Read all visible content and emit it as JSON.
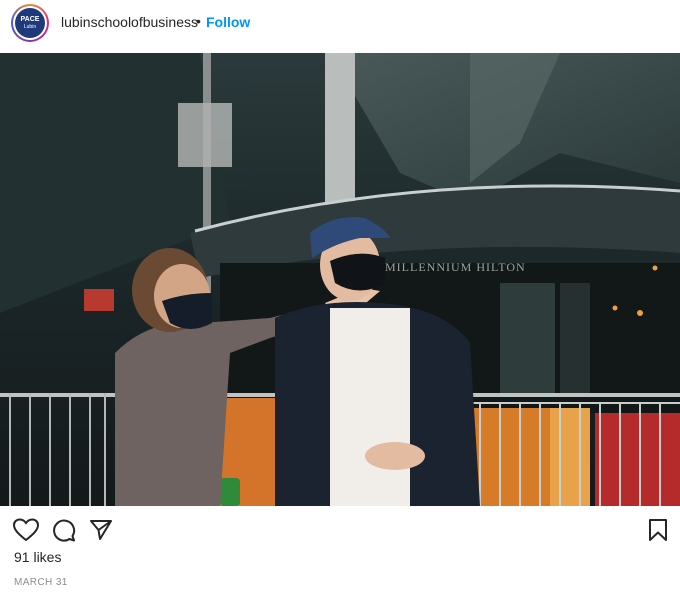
{
  "post": {
    "username": "lubinschoolofbusiness",
    "separator": "•",
    "follow_label": "Follow",
    "avatar": {
      "line1": "PACE",
      "line2": "Lubin",
      "color": "#1e3a7b"
    },
    "photo_sign_text": "MILLENNIUM HILTON",
    "likes_text": "91 likes",
    "date_text": "MARCH 31"
  },
  "icons": {
    "like": "heart-icon",
    "comment": "comment-icon",
    "share": "paper-plane-icon",
    "save": "bookmark-icon",
    "tag": "user-tag-icon"
  },
  "colors": {
    "follow": "#0095f6",
    "text": "#262626",
    "muted": "#8e8e8e"
  }
}
